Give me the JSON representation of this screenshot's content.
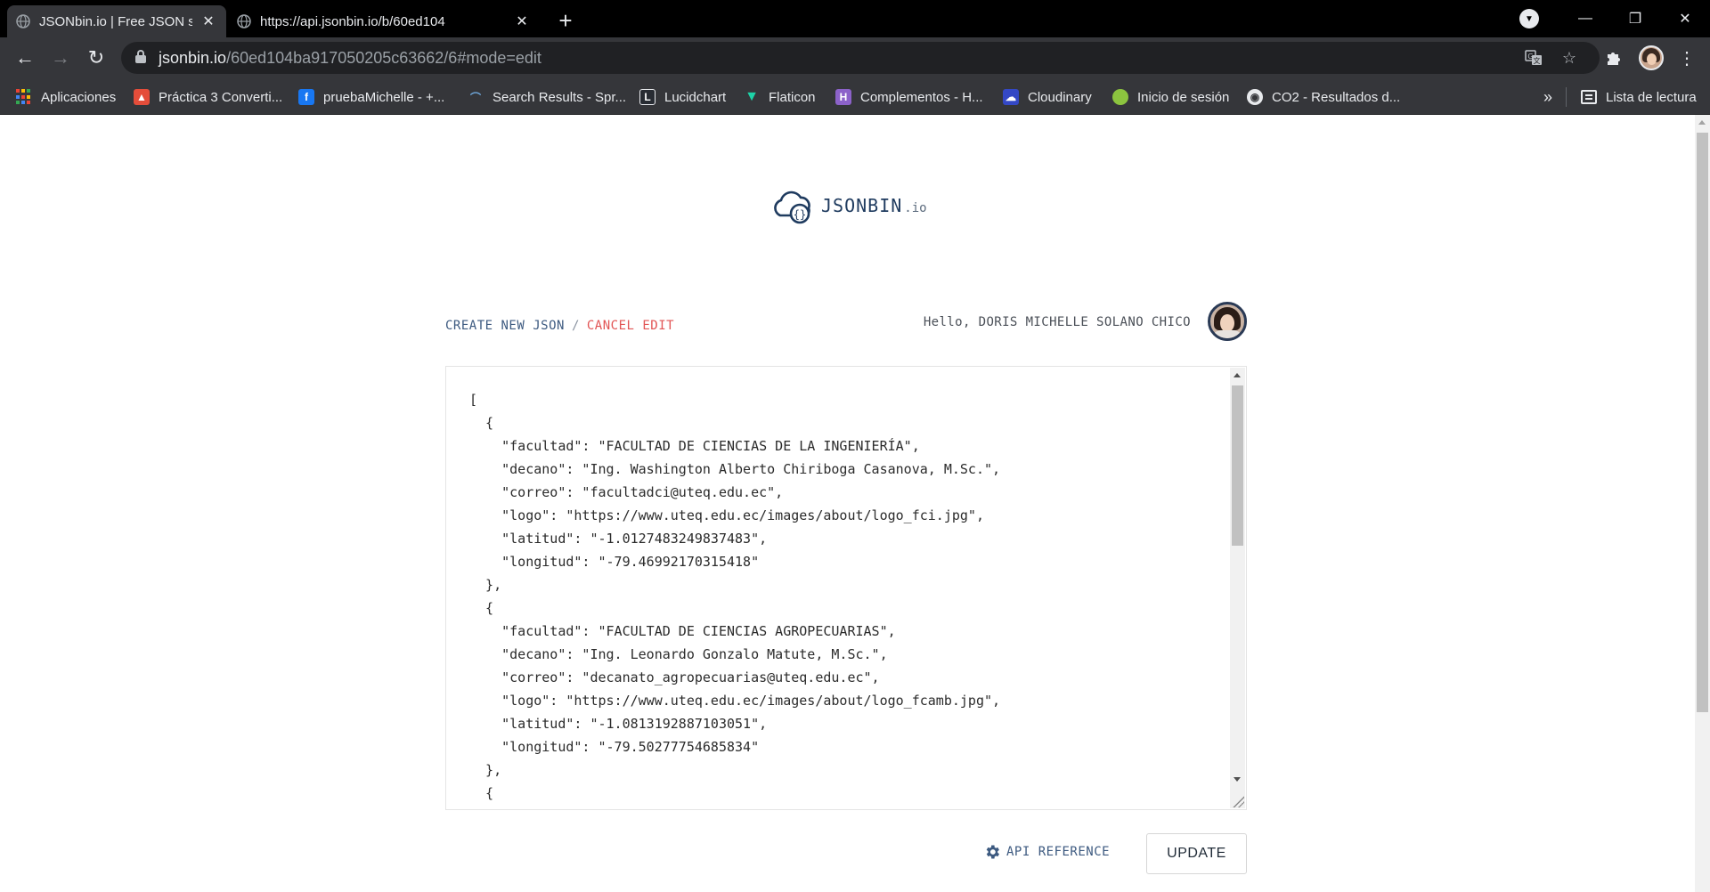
{
  "browser": {
    "tabs": [
      {
        "title": "JSONbin.io | Free JSON storage s",
        "active": true
      },
      {
        "title": "https://api.jsonbin.io/b/60ed104",
        "active": false
      }
    ],
    "url": {
      "host": "jsonbin.io",
      "path": "/60ed104ba917050205c63662/6#mode=edit"
    },
    "bookmarks": [
      {
        "label": "Aplicaciones",
        "icon": "apps-grid-icon"
      },
      {
        "label": "Práctica 3 Converti...",
        "icon": "graduation-cap-icon",
        "color": "#e44d3a"
      },
      {
        "label": "pruebaMichelle - +...",
        "icon": "facebook-icon",
        "color": "#1877f2"
      },
      {
        "label": "Search Results - Spr...",
        "icon": "springer-icon",
        "color": "#1a4f8b"
      },
      {
        "label": "Lucidchart",
        "icon": "lucidchart-icon",
        "color": "#282c33"
      },
      {
        "label": "Flaticon",
        "icon": "flaticon-icon",
        "color": "#1dd3a7"
      },
      {
        "label": "Complementos - H...",
        "icon": "heroku-icon",
        "color": "#8c62c9"
      },
      {
        "label": "Cloudinary",
        "icon": "cloudinary-icon",
        "color": "#3448c5"
      },
      {
        "label": "Inicio de sesión",
        "icon": "login-leaf-icon",
        "color": "#8cc43f"
      },
      {
        "label": "CO2 - Resultados d...",
        "icon": "co2-icon",
        "color": "#e8eaed"
      }
    ],
    "more_bookmarks": "»",
    "reading_list": "Lista de lectura"
  },
  "page": {
    "logo_text": "JSONBIN",
    "logo_sub": ".io",
    "create_link": "CREATE NEW JSON",
    "separator": "/",
    "cancel_link": "CANCEL EDIT",
    "greeting": "Hello, DORIS MICHELLE SOLANO CHICO",
    "editor_content": "[\n  {\n    \"facultad\": \"FACULTAD DE CIENCIAS DE LA INGENIERÍA\",\n    \"decano\": \"Ing. Washington Alberto Chiriboga Casanova, M.Sc.\",\n    \"correo\": \"facultadci@uteq.edu.ec\",\n    \"logo\": \"https://www.uteq.edu.ec/images/about/logo_fci.jpg\",\n    \"latitud\": \"-1.0127483249837483\",\n    \"longitud\": \"-79.46992170315418\"\n  },\n  {\n    \"facultad\": \"FACULTAD DE CIENCIAS AGROPECUARIAS\",\n    \"decano\": \"Ing. Leonardo Gonzalo Matute, M.Sc.\",\n    \"correo\": \"decanato_agropecuarias@uteq.edu.ec\",\n    \"logo\": \"https://www.uteq.edu.ec/images/about/logo_fcamb.jpg\",\n    \"latitud\": \"-1.0813192887103051\",\n    \"longitud\": \"-79.50277754685834\"\n  },\n  {",
    "api_reference": "API REFERENCE",
    "update_button": "UPDATE"
  }
}
